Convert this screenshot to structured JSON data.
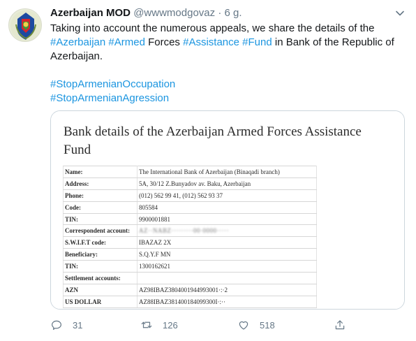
{
  "tweet": {
    "author_name": "Azerbaijan MOD",
    "handle": "@wwwmodgovaz",
    "separator": "·",
    "time": "6 g.",
    "text_lines": [
      [
        {
          "t": "Taking into account the numerous appeals, we share the  details of the",
          "tag": false
        }
      ],
      [
        {
          "t": "#Azerbaijan",
          "tag": true
        },
        {
          "t": " ",
          "tag": false
        },
        {
          "t": "#Armed",
          "tag": true
        },
        {
          "t": " Forces ",
          "tag": false
        },
        {
          "t": "#Assistance",
          "tag": true
        },
        {
          "t": " ",
          "tag": false
        },
        {
          "t": "#Fund",
          "tag": true
        },
        {
          "t": " in Bank of the Republic of",
          "tag": false
        }
      ],
      [
        {
          "t": "Azerbaijan.",
          "tag": false
        }
      ]
    ],
    "hashtag_lines": [
      "#StopArmenianOccupation",
      "#StopArmenianAgression"
    ]
  },
  "card": {
    "title": "Bank details of the Azerbaijan Armed Forces Assistance Fund",
    "rows": [
      {
        "label": "Name:",
        "value": "The International Bank of Azerbaijan (Binaqadi branch)",
        "blurred": false
      },
      {
        "label": "Address:",
        "value": "5A, 30/12  Z.Bunyadov  av. Baku, Azerbaijan",
        "blurred": false
      },
      {
        "label": "Phone:",
        "value": "(012) 562 99 41, (012) 562 93 37",
        "blurred": false
      },
      {
        "label": "Code:",
        "value": "805584",
        "blurred": false
      },
      {
        "label": "TIN:",
        "value": "9900001881",
        "blurred": false
      },
      {
        "label": "Correspondent account:",
        "value": "AZ··NABZ·········00·0000·····",
        "blurred": true
      },
      {
        "label": "S.W.I.F.T code:",
        "value": "IBAZAZ 2X",
        "blurred": false
      },
      {
        "label": "Beneficiary:",
        "value": "S.Q.Y.F MN",
        "blurred": false
      },
      {
        "label": "TIN:",
        "value": "1300162621",
        "blurred": false
      },
      {
        "label": "Settlement accounts:",
        "value": "",
        "blurred": false
      },
      {
        "label": "AZN",
        "value": "AZ98IBAZ3804001944993001·:·2",
        "blurred": false
      },
      {
        "label": "US DOLLAR",
        "value": "AZ88IBAZ381400184099300I·:··",
        "blurred": false
      }
    ]
  },
  "actions": {
    "reply_count": "31",
    "retweet_count": "126",
    "like_count": "518"
  },
  "icons": {
    "reply": "reply-icon",
    "retweet": "retweet-icon",
    "like": "heart-icon",
    "share": "share-icon",
    "menu": "chevron-down-icon"
  },
  "colors": {
    "link": "#1b95e0",
    "muted": "#657786",
    "text": "#14171a",
    "border": "#ccd6dd"
  }
}
